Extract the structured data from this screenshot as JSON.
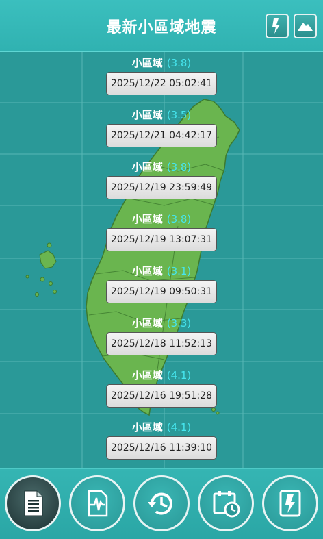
{
  "header": {
    "title": "最新小區域地震",
    "buttons": [
      {
        "name": "lightning-card-icon"
      },
      {
        "name": "mountain-icon"
      }
    ]
  },
  "quakes": [
    {
      "label": "小區域",
      "magnitude": "(3.8)",
      "time": "2025/12/22 05:02:41"
    },
    {
      "label": "小區域",
      "magnitude": "(3.5)",
      "time": "2025/12/21 04:42:17"
    },
    {
      "label": "小區域",
      "magnitude": "(3.8)",
      "time": "2025/12/19 23:59:49"
    },
    {
      "label": "小區域",
      "magnitude": "(3.8)",
      "time": "2025/12/19 13:07:31"
    },
    {
      "label": "小區域",
      "magnitude": "(3.1)",
      "time": "2025/12/19 09:50:31"
    },
    {
      "label": "小區域",
      "magnitude": "(3.3)",
      "time": "2025/12/18 11:52:13"
    },
    {
      "label": "小區域",
      "magnitude": "(4.1)",
      "time": "2025/12/16 19:51:28"
    },
    {
      "label": "小區域",
      "magnitude": "(4.1)",
      "time": "2025/12/16 11:39:10"
    }
  ],
  "footer": {
    "nav": [
      {
        "icon": "document-list-icon",
        "active": true
      },
      {
        "icon": "seismograph-icon",
        "active": false
      },
      {
        "icon": "history-clock-icon",
        "active": false
      },
      {
        "icon": "calendar-clock-icon",
        "active": false
      },
      {
        "icon": "lightning-card-icon",
        "active": false
      }
    ]
  },
  "colors": {
    "sea": "#2a9998",
    "land": "#6ab54f",
    "header": "#33b5b3",
    "magnitude": "#46e6ef"
  }
}
